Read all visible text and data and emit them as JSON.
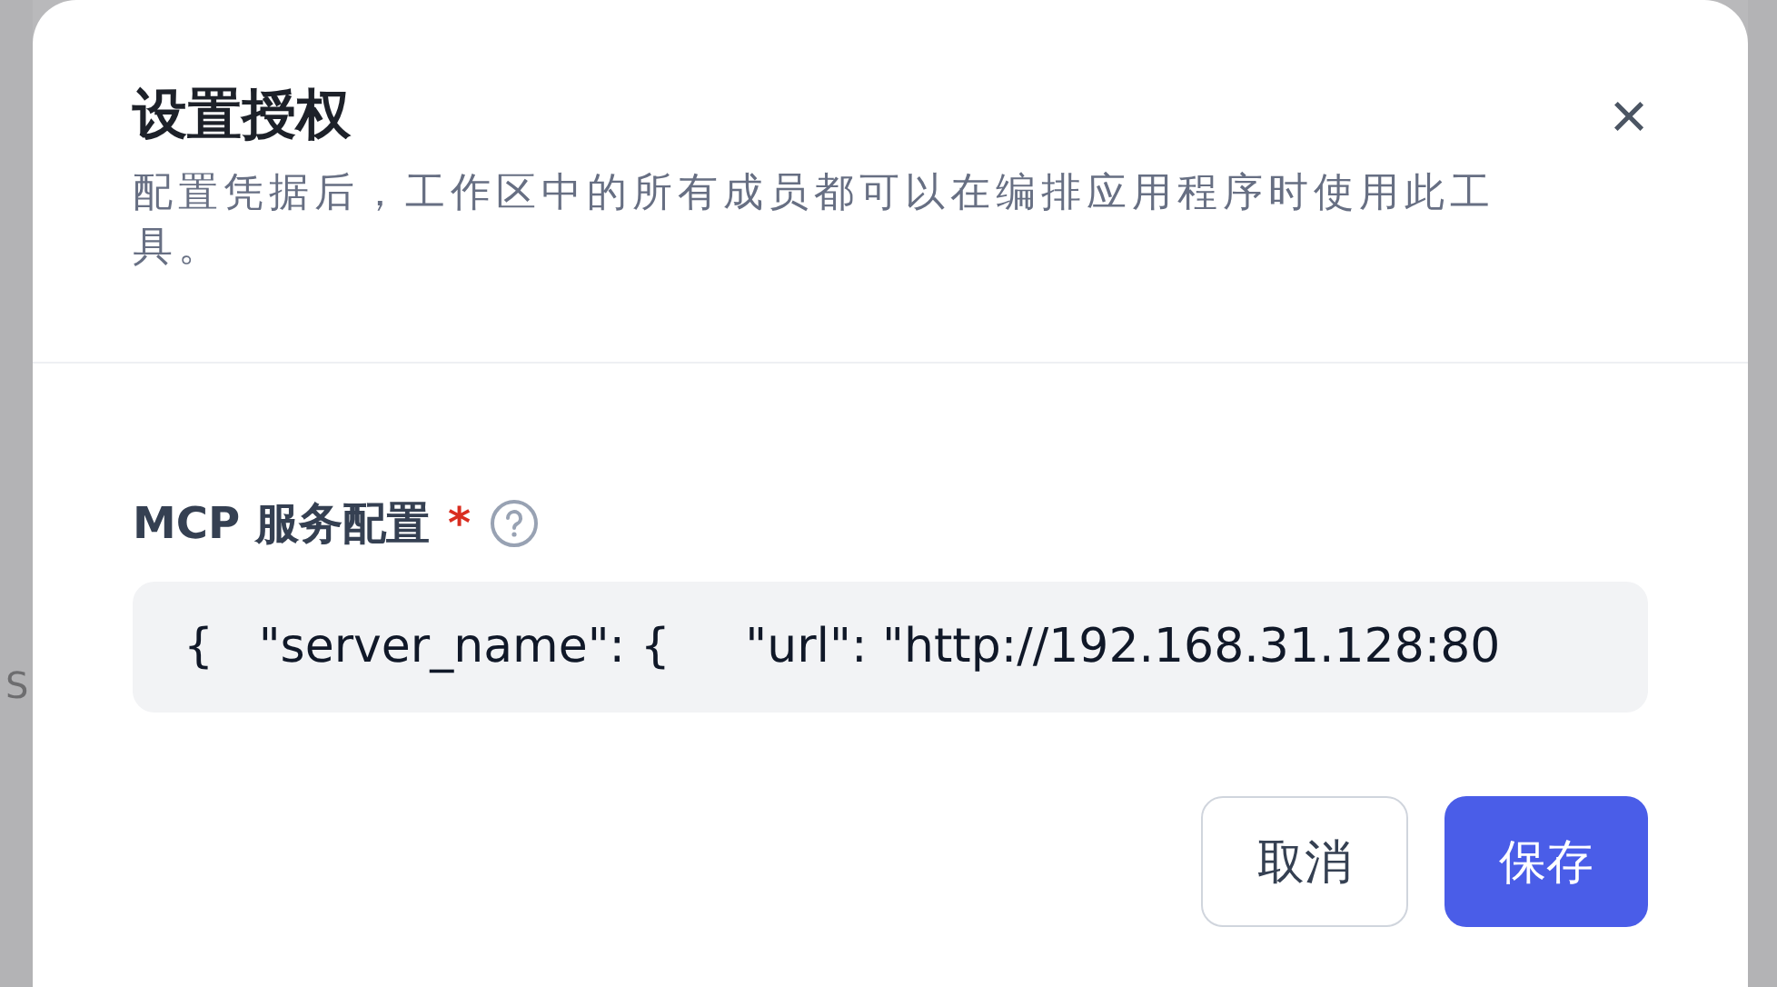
{
  "backdrop_text": "S",
  "dialog": {
    "title": "设置授权",
    "close": "×",
    "description": "配置凭据后，工作区中的所有成员都可以在编排应用程序时使用此工具。",
    "field": {
      "label": "MCP 服务配置",
      "required_mark": "*",
      "value": "{   \"server_name\": {     \"url\": \"http://192.168.31.128:80"
    },
    "buttons": [
      {
        "label": "取消",
        "kind": "secondary"
      },
      {
        "label": "保存",
        "kind": "primary"
      }
    ]
  }
}
